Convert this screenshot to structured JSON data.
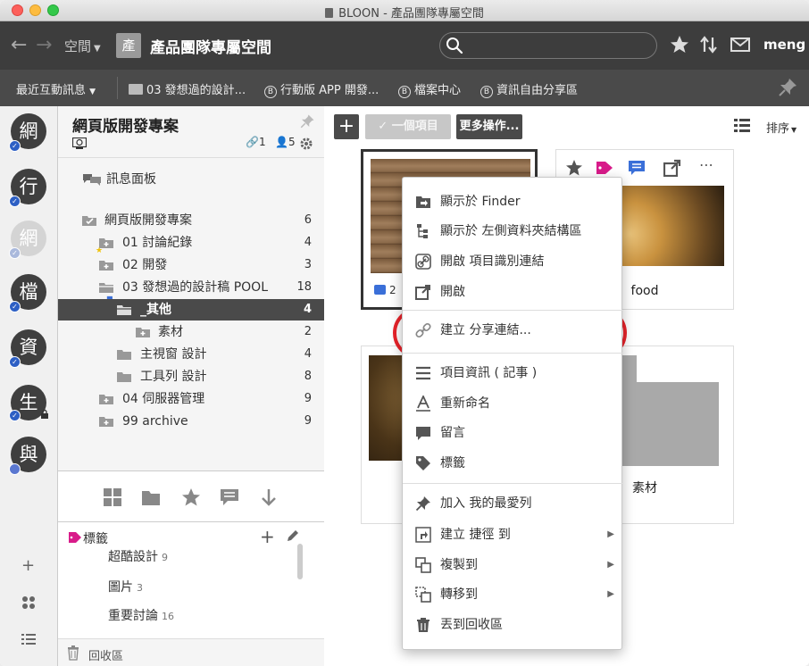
{
  "window": {
    "title": "BLOON - 產品團隊專屬空間"
  },
  "toolbar": {
    "space_label": "空間",
    "space_badge": "產",
    "space_title": "產品團隊專屬空間",
    "user": "meng"
  },
  "breadcrumbs": {
    "recent": "最近互動訊息",
    "items": [
      {
        "icon": "folder-icon",
        "label": "03 發想過的設計..."
      },
      {
        "icon": "b-circle-icon",
        "label": "行動版 APP 開發..."
      },
      {
        "icon": "b-circle-icon",
        "label": "檔案中心"
      },
      {
        "icon": "b-circle-icon",
        "label": "資訊自由分享區"
      }
    ]
  },
  "rail": {
    "items": [
      {
        "char": "網",
        "light": false
      },
      {
        "char": "行",
        "light": false
      },
      {
        "char": "網",
        "light": true
      },
      {
        "char": "檔",
        "light": false
      },
      {
        "char": "資",
        "light": false
      },
      {
        "char": "生",
        "light": false
      },
      {
        "char": "與",
        "light": false
      }
    ]
  },
  "sidebar": {
    "title": "網頁版開發專案",
    "link_count": "1",
    "member_count": "5",
    "message_board": "訊息面板",
    "tree": [
      {
        "label": "網頁版開發專案",
        "count": "6"
      },
      {
        "label": "01 討論紀錄",
        "count": "4"
      },
      {
        "label": "02 開發",
        "count": "3"
      },
      {
        "label": "03 發想過的設計稿 POOL",
        "count": "18"
      },
      {
        "label": "_其他",
        "count": "4"
      },
      {
        "label": "素材",
        "count": "2"
      },
      {
        "label": "主視窗 設計",
        "count": "4"
      },
      {
        "label": "工具列 設計",
        "count": "8"
      },
      {
        "label": "04 伺服器管理",
        "count": "9"
      },
      {
        "label": "99 archive",
        "count": "9"
      }
    ],
    "tags_title": "標籤",
    "tags": [
      {
        "label": "超酷設計",
        "count": "9"
      },
      {
        "label": "圖片",
        "count": "3"
      },
      {
        "label": "重要討論",
        "count": "16"
      }
    ],
    "trash": "回收區"
  },
  "main": {
    "selected_label": "一個項目",
    "more_label": "更多操作...",
    "sort_label": "排序",
    "cards": [
      {
        "name": "",
        "comments": "2"
      },
      {
        "name": "food"
      },
      {
        "name": ""
      },
      {
        "name": "素材"
      }
    ]
  },
  "context_menu": {
    "items": [
      {
        "label": "顯示於 Finder",
        "icon": "finder-icon"
      },
      {
        "label": "顯示於 左側資料夾結構區",
        "icon": "tree-icon"
      },
      {
        "label": "開啟 項目識別連結",
        "icon": "link-icon"
      },
      {
        "label": "開啟",
        "icon": "open-external-icon"
      },
      {
        "label": "建立 分享連結...",
        "icon": "share-link-icon"
      },
      {
        "label": "項目資訊 ( 記事 )",
        "icon": "info-lines-icon"
      },
      {
        "label": "重新命名",
        "icon": "rename-icon"
      },
      {
        "label": "留言",
        "icon": "comment-icon"
      },
      {
        "label": "標籤",
        "icon": "tag-icon"
      },
      {
        "label": "加入 我的最愛列",
        "icon": "pin-icon"
      },
      {
        "label": "建立 捷徑 到",
        "icon": "shortcut-icon"
      },
      {
        "label": "複製到",
        "icon": "copy-icon"
      },
      {
        "label": "轉移到",
        "icon": "move-icon"
      },
      {
        "label": "丟到回收區",
        "icon": "trash-icon"
      }
    ]
  },
  "colors": {
    "toolbar_bg": "#3d3d3d",
    "crumbbar_bg": "#4a4a4a",
    "accent_blue": "#2d5fc4",
    "highlight_red": "#e8232a",
    "tag_pink": "#d81b8a",
    "link_green": "#2e9c3a"
  }
}
